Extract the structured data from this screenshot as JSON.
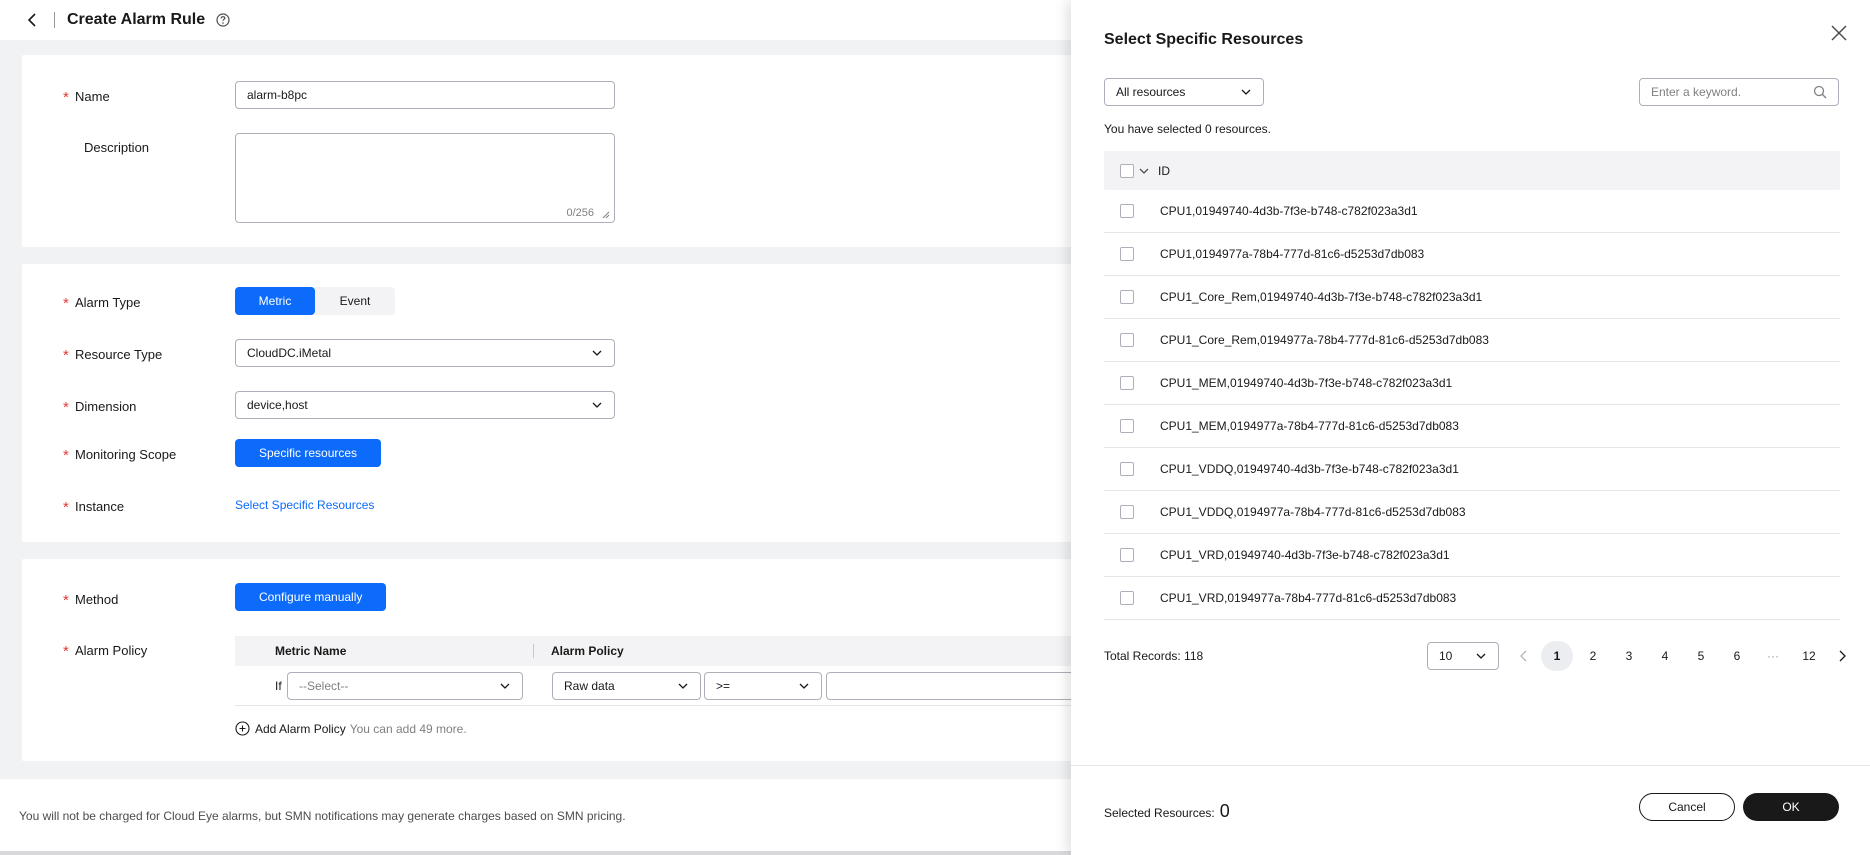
{
  "header": {
    "title": "Create Alarm Rule"
  },
  "basic": {
    "name_label": "Name",
    "name_value": "alarm-b8pc",
    "description_label": "Description",
    "description_counter": "0/256"
  },
  "config": {
    "alarm_type_label": "Alarm Type",
    "alarm_type_options": [
      "Metric",
      "Event"
    ],
    "resource_type_label": "Resource Type",
    "resource_type_value": "CloudDC.iMetal",
    "dimension_label": "Dimension",
    "dimension_value": "device,host",
    "monitoring_scope_label": "Monitoring Scope",
    "monitoring_scope_button": "Specific resources",
    "instance_label": "Instance",
    "instance_link": "Select Specific Resources"
  },
  "policy": {
    "method_label": "Method",
    "method_button": "Configure manually",
    "alarm_policy_label": "Alarm Policy",
    "col_metric_name": "Metric Name",
    "col_alarm_policy": "Alarm Policy",
    "if_label": "If",
    "metric_placeholder": "--Select--",
    "raw_data": "Raw data",
    "operator": ">=",
    "add_policy": "Add Alarm Policy",
    "add_policy_hint": "You can add 49 more."
  },
  "footer": {
    "notice": "You will not be charged for Cloud Eye alarms, but SMN notifications may generate charges based on SMN pricing."
  },
  "drawer": {
    "title": "Select Specific Resources",
    "filter_value": "All resources",
    "search_placeholder": "Enter a keyword.",
    "selected_text": "You have selected 0 resources.",
    "column_id": "ID",
    "rows": [
      "CPU1,01949740-4d3b-7f3e-b748-c782f023a3d1",
      "CPU1,0194977a-78b4-777d-81c6-d5253d7db083",
      "CPU1_Core_Rem,01949740-4d3b-7f3e-b748-c782f023a3d1",
      "CPU1_Core_Rem,0194977a-78b4-777d-81c6-d5253d7db083",
      "CPU1_MEM,01949740-4d3b-7f3e-b748-c782f023a3d1",
      "CPU1_MEM,0194977a-78b4-777d-81c6-d5253d7db083",
      "CPU1_VDDQ,01949740-4d3b-7f3e-b748-c782f023a3d1",
      "CPU1_VDDQ,0194977a-78b4-777d-81c6-d5253d7db083",
      "CPU1_VRD,01949740-4d3b-7f3e-b748-c782f023a3d1",
      "CPU1_VRD,0194977a-78b4-777d-81c6-d5253d7db083"
    ],
    "total_records": "Total Records: 118",
    "page_size": "10",
    "pages": [
      "1",
      "2",
      "3",
      "4",
      "5",
      "6",
      "···",
      "12"
    ],
    "selected_resources_label": "Selected Resources:",
    "selected_resources_count": "0",
    "cancel": "Cancel",
    "ok": "OK"
  },
  "colors": {
    "primary": "#0d6bfb",
    "required": "#e33a3a",
    "dark_button": "#191919"
  }
}
